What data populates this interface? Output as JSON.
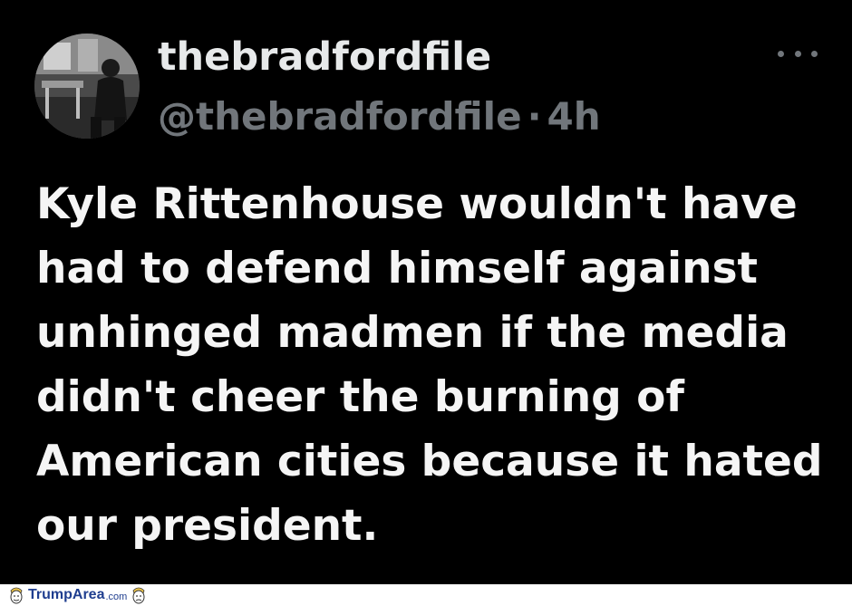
{
  "tweet": {
    "display_name": "thebradfordfile",
    "handle": "@thebradfordfile",
    "separator": "·",
    "time": "4h",
    "text": "Kyle Rittenhouse wouldn't have\nhad to defend himself against\nunhinged madmen if the media\ndidn't cheer the burning of\nAmerican cities because it hated\nour president.",
    "more_icon": "more-horizontal-icon"
  },
  "watermark": {
    "brand": "TrumpArea",
    "tld": ".com"
  },
  "colors": {
    "background": "#000000",
    "primary_text": "#e7e9ea",
    "secondary_text": "#71767b",
    "watermark_blue": "#1f3e8f"
  }
}
